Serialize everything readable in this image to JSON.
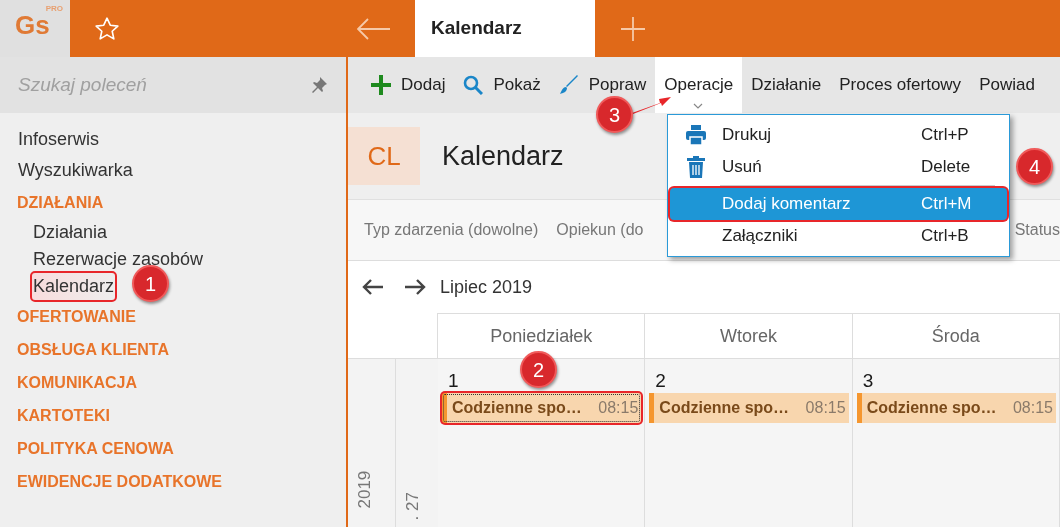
{
  "logo": {
    "text": "Gs",
    "superscript": "PRO"
  },
  "tabs": [
    {
      "label": "Kalendarz",
      "selected": true
    }
  ],
  "sidebar": {
    "search": {
      "placeholder": "Szukaj poleceń"
    },
    "items": [
      {
        "kind": "link",
        "label": "Infoserwis",
        "selected": false,
        "highlighted": false
      },
      {
        "kind": "link",
        "label": "Wyszukiwarka",
        "selected": false,
        "highlighted": false
      },
      {
        "kind": "section",
        "label": "DZIAŁANIA",
        "children": [
          {
            "kind": "link",
            "label": "Działania",
            "selected": false,
            "highlighted": false
          },
          {
            "kind": "link",
            "label": "Rezerwacje zasobów",
            "selected": false,
            "highlighted": false
          },
          {
            "kind": "link",
            "label": "Kalendarz",
            "selected": true,
            "highlighted": true
          }
        ]
      },
      {
        "kind": "section",
        "label": "OFERTOWANIE"
      },
      {
        "kind": "section",
        "label": "OBSŁUGA KLIENTA"
      },
      {
        "kind": "section",
        "label": "KOMUNIKACJA"
      },
      {
        "kind": "section",
        "label": "KARTOTEKI"
      },
      {
        "kind": "section",
        "label": "POLITYKA CENOWA"
      },
      {
        "kind": "section",
        "label": "EWIDENCJE DODATKOWE"
      }
    ]
  },
  "toolbar": [
    {
      "kind": "add",
      "label": "Dodaj",
      "expanded": false
    },
    {
      "kind": "show",
      "label": "Pokaż",
      "expanded": false
    },
    {
      "kind": "edit",
      "label": "Popraw",
      "expanded": false
    },
    {
      "kind": "menu",
      "label": "Operacje",
      "expanded": true
    },
    {
      "kind": "menu",
      "label": "Działanie",
      "expanded": false
    },
    {
      "kind": "menu",
      "label": "Proces ofertowy",
      "expanded": false
    },
    {
      "kind": "menu",
      "label": "Powiad",
      "expanded": false
    }
  ],
  "menu": {
    "items": [
      {
        "kind": "print",
        "label": "Drukuj",
        "shortcut": "Ctrl+P",
        "selected": false,
        "highlighted": false,
        "separator_after": false
      },
      {
        "kind": "delete",
        "label": "Usuń",
        "shortcut": "Delete",
        "selected": false,
        "highlighted": false,
        "separator_after": true
      },
      {
        "kind": "plain",
        "label": "Dodaj komentarz",
        "shortcut": "Ctrl+M",
        "selected": true,
        "highlighted": true,
        "separator_after": false
      },
      {
        "kind": "plain",
        "label": "Załączniki",
        "shortcut": "Ctrl+B",
        "selected": false,
        "highlighted": false,
        "separator_after": false
      }
    ]
  },
  "header": {
    "badge": "CL",
    "title": "Kalendarz"
  },
  "filters": [
    "Typ zdarzenia (dowolne)",
    "Opiekun (do",
    "Status"
  ],
  "calendar": {
    "month": "Lipiec 2019",
    "columns": [
      "Poniedziałek",
      "Wtorek",
      "Środa"
    ],
    "year_label": "2019",
    "week_label": ". 27",
    "days": [
      {
        "number": "1",
        "events": [
          {
            "title": "Codzienne spo…",
            "time": "08:15",
            "selected": true,
            "highlighted": true
          }
        ]
      },
      {
        "number": "2",
        "events": [
          {
            "title": "Codzienne spo…",
            "time": "08:15",
            "selected": false,
            "highlighted": false
          }
        ]
      },
      {
        "number": "3",
        "events": [
          {
            "title": "Codzienne spo…",
            "time": "08:15",
            "selected": false,
            "highlighted": false
          }
        ]
      }
    ]
  },
  "annotations": [
    {
      "label": "1"
    },
    {
      "label": "2"
    },
    {
      "label": "3"
    },
    {
      "label": "4"
    }
  ]
}
